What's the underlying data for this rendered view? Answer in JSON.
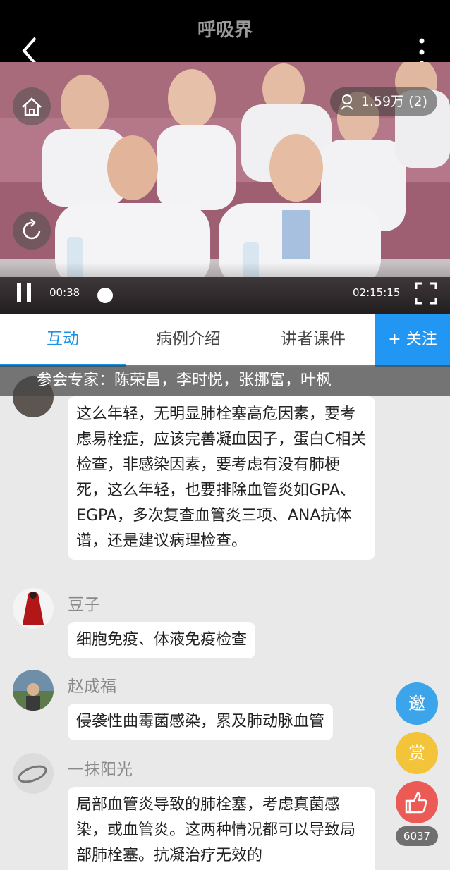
{
  "app": {
    "title": "呼吸界"
  },
  "video": {
    "viewers": "1.59万 (2)",
    "current_time": "00:38",
    "total_time": "02:15:15",
    "progress": 0.005
  },
  "tabs": [
    {
      "label": "互动",
      "active": true
    },
    {
      "label": "病例介绍",
      "active": false
    },
    {
      "label": "讲者课件",
      "active": false
    }
  ],
  "follow_label": "+ 关注",
  "experts_banner": "参会专家：陈荣昌，李时悦，张挪富，叶枫",
  "messages": [
    {
      "name": "",
      "text": "这么年轻，无明显肺栓塞高危因素，要考虑易栓症，应该完善凝血因子，蛋白C相关检查，非感染因素，要考虑有没有肺梗死，这么年轻，也要排除血管炎如GPA、EGPA，多次复查血管炎三项、ANA抗体谱，还是建议病理检查。"
    },
    {
      "name": "豆子",
      "text": "细胞免疫、体液免疫检查"
    },
    {
      "name": "赵成福",
      "text": "侵袭性曲霉菌感染，累及肺动脉血管"
    },
    {
      "name": "一抹阳光",
      "text": "局部血管炎导致的肺栓塞，考虑真菌感染，或血管炎。这两种情况都可以导致局部肺栓塞。抗凝治疗无效的"
    }
  ],
  "floating": {
    "invite_label": "邀",
    "reward_label": "赏",
    "like_count": "6037"
  },
  "colors": {
    "accent": "#2196f3",
    "invite": "#3ba4ea",
    "reward": "#f3c43a",
    "like": "#ec5a55"
  }
}
